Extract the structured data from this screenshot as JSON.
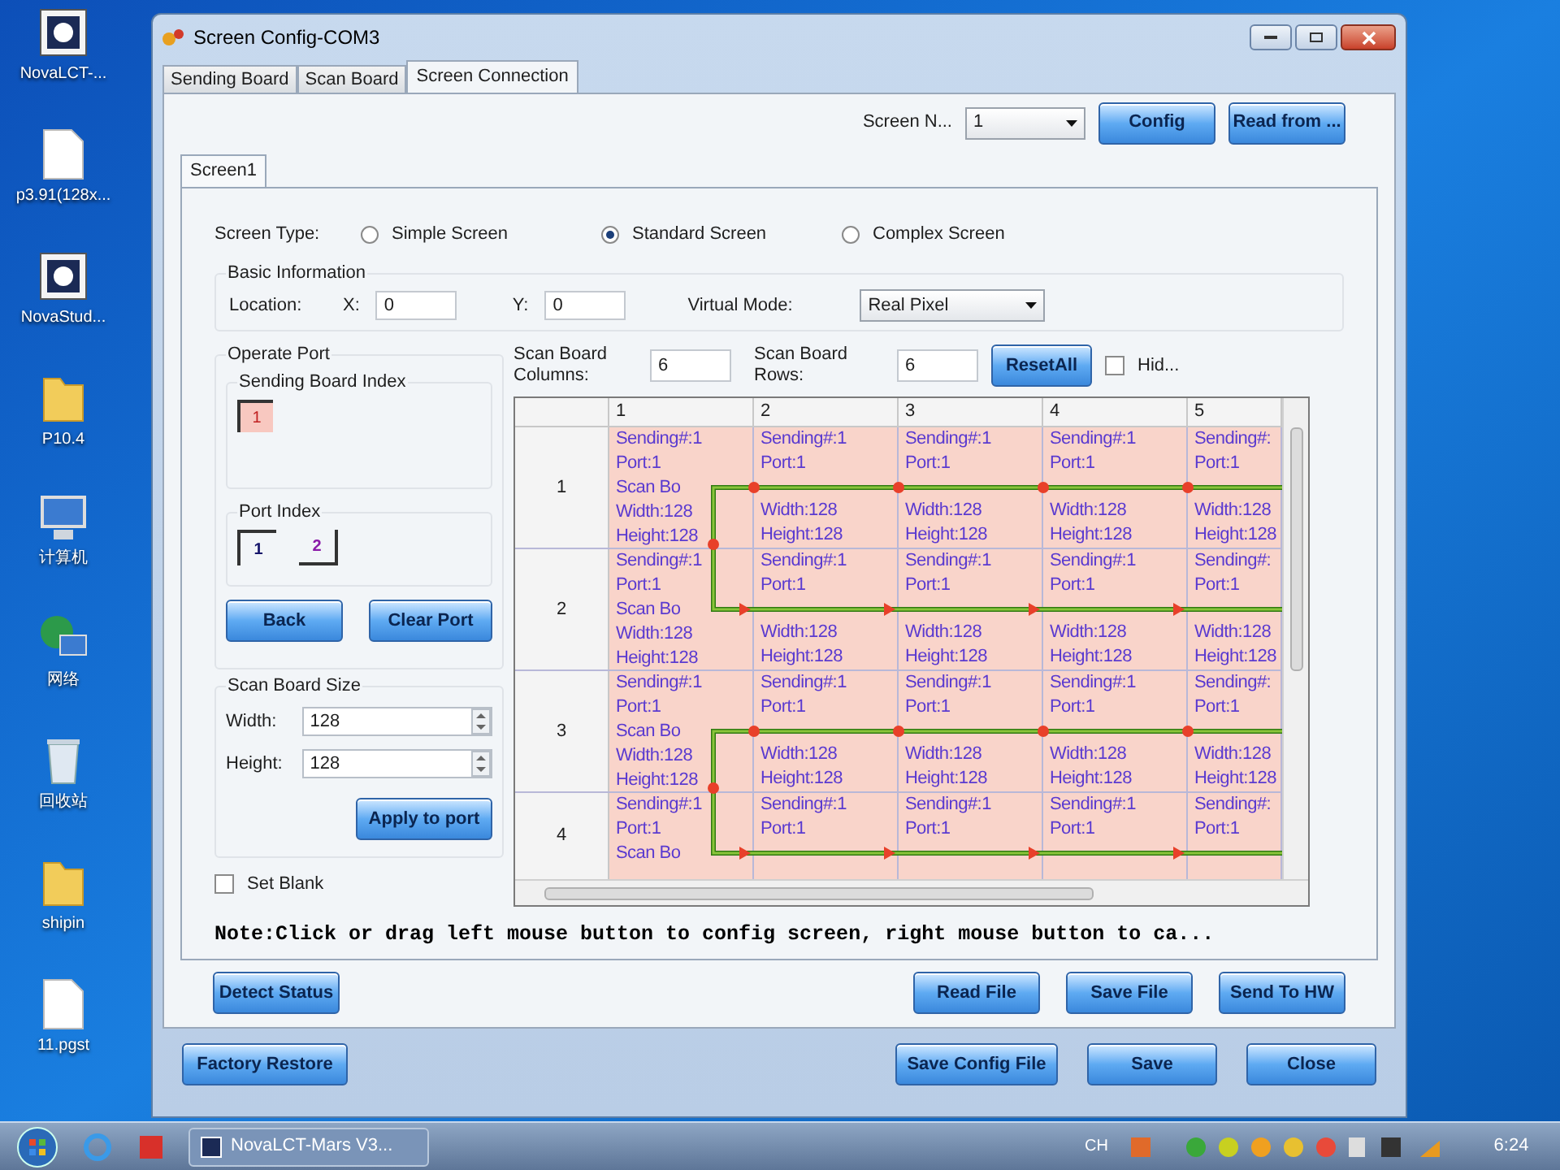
{
  "desktop_icons": [
    {
      "label": "NovaLCT-...",
      "kind": "app"
    },
    {
      "label": "p3.91(128x...",
      "kind": "document"
    },
    {
      "label": "NovaStud...",
      "kind": "app"
    },
    {
      "label": "P10.4",
      "kind": "folder"
    },
    {
      "label": "计算机",
      "kind": "computer"
    },
    {
      "label": "网络",
      "kind": "network"
    },
    {
      "label": "回收站",
      "kind": "recycle"
    },
    {
      "label": "shipin",
      "kind": "folder"
    },
    {
      "label": "11.pgst",
      "kind": "document"
    }
  ],
  "window": {
    "title": "Screen Config-COM3"
  },
  "tabs": [
    {
      "label": "Sending Board",
      "selected": false
    },
    {
      "label": "Scan Board",
      "selected": false
    },
    {
      "label": "Screen Connection",
      "selected": true
    }
  ],
  "screen_selector": {
    "label": "Screen N...",
    "value": "1"
  },
  "top_buttons": [
    "Config",
    "Read from ..."
  ],
  "screen_tabs": [
    {
      "label": "Screen1",
      "selected": true
    }
  ],
  "screen_type": {
    "label": "Screen Type:",
    "options": [
      {
        "label": "Simple Screen",
        "selected": false
      },
      {
        "label": "Standard Screen",
        "selected": true
      },
      {
        "label": "Complex Screen",
        "selected": false
      }
    ]
  },
  "basic_information": {
    "title": "Basic Information",
    "location_label": "Location:",
    "x_label": "X:",
    "x_value": "0",
    "y_label": "Y:",
    "y_value": "0",
    "virtual_mode_label": "Virtual Mode:",
    "virtual_mode_value": "Real Pixel"
  },
  "operate_port": {
    "title": "Operate Port",
    "sending_board_index": {
      "title": "Sending Board Index",
      "items": [
        {
          "label": "1",
          "selected": true
        }
      ]
    },
    "port_index": {
      "title": "Port Index",
      "items": [
        {
          "label": "1",
          "selected": true
        },
        {
          "label": "2",
          "selected": false
        }
      ]
    },
    "buttons": [
      "Back",
      "Clear Port"
    ]
  },
  "scan_board_size": {
    "title": "Scan Board Size",
    "width_label": "Width:",
    "width_value": "128",
    "height_label": "Height:",
    "height_value": "128",
    "button": "Apply to port"
  },
  "set_blank": {
    "label": "Set Blank",
    "checked": false
  },
  "scan_board_columns": {
    "label": "Scan Board Columns:",
    "value": "6"
  },
  "scan_board_rows": {
    "label": "Scan Board Rows:",
    "value": "6"
  },
  "reset_button": "ResetAll",
  "hide": {
    "label": "Hid...",
    "checked": false
  },
  "grid": {
    "columns": [
      "1",
      "2",
      "3",
      "4",
      "5"
    ],
    "rows": [
      {
        "label": "1",
        "cells": [
          {
            "top": [
              "Sending#:1",
              "Port:1"
            ],
            "scan": "Scan Bo",
            "bottom": [
              "Width:128",
              "Height:128"
            ]
          },
          {
            "top": [
              "Sending#:1",
              "Port:1"
            ],
            "bottom": [
              "Width:128",
              "Height:128"
            ]
          },
          {
            "top": [
              "Sending#:1",
              "Port:1"
            ],
            "bottom": [
              "Width:128",
              "Height:128"
            ]
          },
          {
            "top": [
              "Sending#:1",
              "Port:1"
            ],
            "bottom": [
              "Width:128",
              "Height:128"
            ]
          },
          {
            "top": [
              "Sending#:",
              "Port:1"
            ],
            "bottom": [
              "Width:128",
              "Height:128"
            ]
          }
        ]
      },
      {
        "label": "2",
        "cells": [
          {
            "top": [
              "Sending#:1",
              "Port:1"
            ],
            "scan": "Scan Bo",
            "bottom": [
              "Width:128",
              "Height:128"
            ]
          },
          {
            "top": [
              "Sending#:1",
              "Port:1"
            ],
            "bottom": [
              "Width:128",
              "Height:128"
            ]
          },
          {
            "top": [
              "Sending#:1",
              "Port:1"
            ],
            "bottom": [
              "Width:128",
              "Height:128"
            ]
          },
          {
            "top": [
              "Sending#:1",
              "Port:1"
            ],
            "bottom": [
              "Width:128",
              "Height:128"
            ]
          },
          {
            "top": [
              "Sending#:",
              "Port:1"
            ],
            "bottom": [
              "Width:128",
              "Height:128"
            ]
          }
        ]
      },
      {
        "label": "3",
        "cells": [
          {
            "top": [
              "Sending#:1",
              "Port:1"
            ],
            "scan": "Scan Bo",
            "bottom": [
              "Width:128",
              "Height:128"
            ]
          },
          {
            "top": [
              "Sending#:1",
              "Port:1"
            ],
            "bottom": [
              "Width:128",
              "Height:128"
            ]
          },
          {
            "top": [
              "Sending#:1",
              "Port:1"
            ],
            "bottom": [
              "Width:128",
              "Height:128"
            ]
          },
          {
            "top": [
              "Sending#:1",
              "Port:1"
            ],
            "bottom": [
              "Width:128",
              "Height:128"
            ]
          },
          {
            "top": [
              "Sending#:",
              "Port:1"
            ],
            "bottom": [
              "Width:128",
              "Height:128"
            ]
          }
        ]
      },
      {
        "label": "4",
        "cells": [
          {
            "top": [
              "Sending#:1",
              "Port:1"
            ],
            "scan": "Scan Bo"
          },
          {
            "top": [
              "Sending#:1",
              "Port:1"
            ]
          },
          {
            "top": [
              "Sending#:1",
              "Port:1"
            ]
          },
          {
            "top": [
              "Sending#:1",
              "Port:1"
            ]
          },
          {
            "top": [
              "Sending#:",
              "Port:1"
            ]
          }
        ]
      }
    ]
  },
  "note": "Note:Click or drag left mouse button to config screen, right mouse button to ca...",
  "panel_buttons": {
    "left": [
      "Detect Status"
    ],
    "right": [
      "Read File",
      "Save File",
      "Send To HW"
    ]
  },
  "footer_buttons": {
    "left": [
      "Factory Restore"
    ],
    "right": [
      "Save Config File",
      "Save",
      "Close"
    ]
  },
  "taskbar": {
    "tasks": [
      {
        "label": "NovaLCT-Mars V3..."
      }
    ],
    "tray_language": "CH",
    "clock": "6:24"
  }
}
